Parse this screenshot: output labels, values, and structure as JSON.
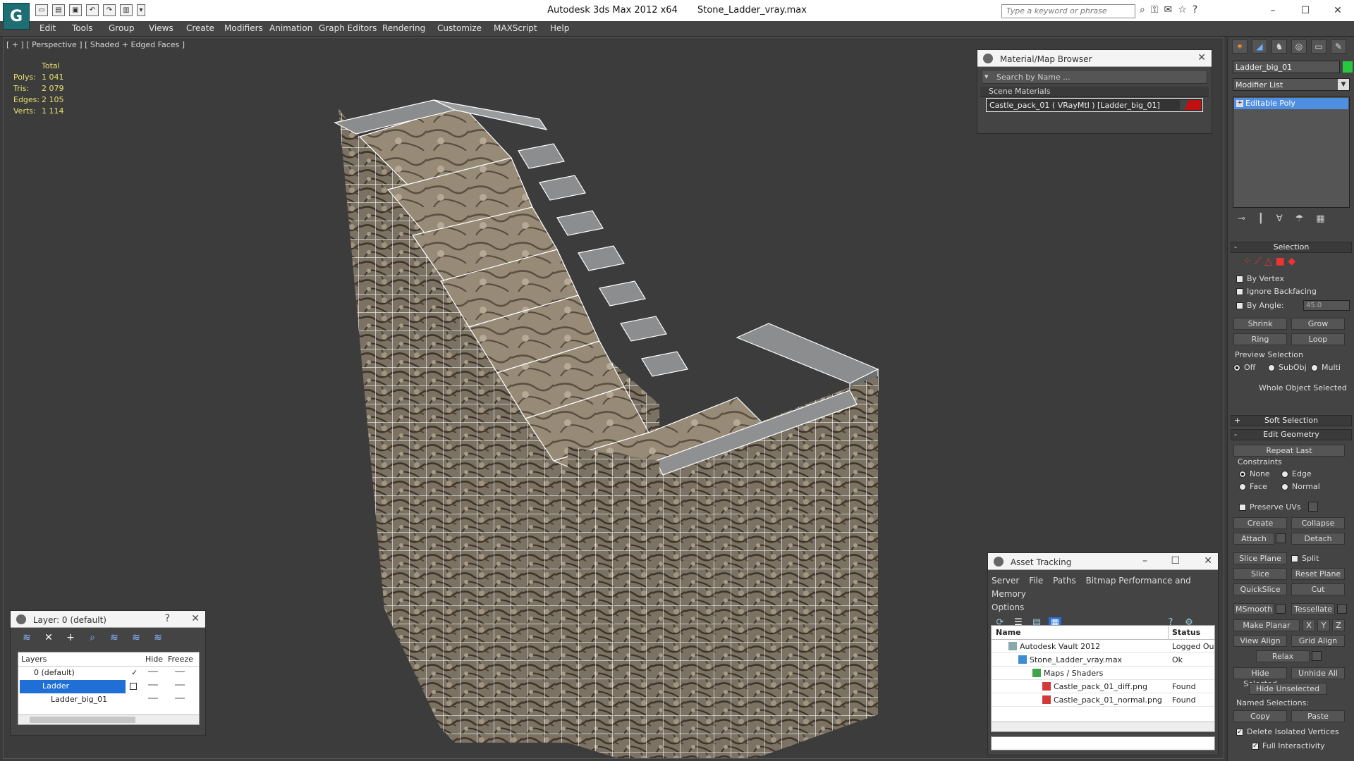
{
  "window": {
    "app_title": "Autodesk 3ds Max  2012 x64",
    "file_title": "Stone_Ladder_vray.max",
    "search_placeholder": "Type a keyword or phrase",
    "logo_glyph": "G"
  },
  "menu": [
    "Edit",
    "Tools",
    "Group",
    "Views",
    "Create",
    "Modifiers",
    "Animation",
    "Graph Editors",
    "Rendering",
    "Customize",
    "MAXScript",
    "Help"
  ],
  "viewport": {
    "label": "[ + ] [ Perspective ] [ Shaded + Edged Faces ]",
    "stats": {
      "header": "Total",
      "rows": [
        {
          "k": "Polys:",
          "v": "1 041"
        },
        {
          "k": "Tris:",
          "v": "2 079"
        },
        {
          "k": "Edges:",
          "v": "2 105"
        },
        {
          "k": "Verts:",
          "v": "1 114"
        }
      ]
    }
  },
  "material_browser": {
    "title": "Material/Map Browser",
    "search_placeholder": "Search by Name ...",
    "section": "Scene Materials",
    "item": "Castle_pack_01  ( VRayMtl )  [Ladder_big_01]"
  },
  "command_panel": {
    "object_name": "Ladder_big_01",
    "modifier_list": "Modifier List",
    "stack_item": "Editable Poly",
    "selection": {
      "header": "Selection",
      "by_vertex": "By Vertex",
      "ignore_backfacing": "Ignore Backfacing",
      "by_angle": "By Angle:",
      "angle_value": "45.0",
      "shrink": "Shrink",
      "grow": "Grow",
      "ring": "Ring",
      "loop": "Loop",
      "preview_selection": "Preview Selection",
      "off": "Off",
      "subobj": "SubObj",
      "multi": "Multi",
      "status": "Whole Object Selected"
    },
    "soft_selection": "Soft Selection",
    "edit_geometry": {
      "header": "Edit Geometry",
      "repeat_last": "Repeat Last",
      "constraints": "Constraints",
      "none": "None",
      "edge": "Edge",
      "face": "Face",
      "normal": "Normal",
      "preserve_uvs": "Preserve UVs",
      "create": "Create",
      "collapse": "Collapse",
      "attach": "Attach",
      "detach": "Detach",
      "slice_plane": "Slice Plane",
      "split": "Split",
      "slice": "Slice",
      "reset_plane": "Reset Plane",
      "quickslice": "QuickSlice",
      "cut": "Cut",
      "msmooth": "MSmooth",
      "tessellate": "Tessellate",
      "make_planar": "Make Planar",
      "x": "X",
      "y": "Y",
      "z": "Z",
      "view_align": "View Align",
      "grid_align": "Grid Align",
      "relax": "Relax",
      "hide_selected": "Hide Selected",
      "unhide_all": "Unhide All",
      "hide_unselected": "Hide Unselected",
      "named_selections": "Named Selections:",
      "copy": "Copy",
      "paste": "Paste",
      "delete_isolated": "Delete Isolated Vertices",
      "full_interactivity": "Full Interactivity"
    }
  },
  "layer_panel": {
    "title": "Layer: 0 (default)",
    "help": "?",
    "columns": {
      "layers": "Layers",
      "hide": "Hide",
      "freeze": "Freeze"
    },
    "rows": [
      {
        "name": "0 (default)"
      },
      {
        "name": "Ladder"
      },
      {
        "name": "Ladder_big_01"
      }
    ]
  },
  "asset_tracking": {
    "title": "Asset Tracking",
    "menu": [
      "Server",
      "File",
      "Paths",
      "Bitmap Performance and Memory",
      "Options"
    ],
    "columns": {
      "name": "Name",
      "status": "Status"
    },
    "rows": [
      {
        "name": "Autodesk Vault 2012",
        "status": "Logged Ou"
      },
      {
        "name": "Stone_Ladder_vray.max",
        "status": "Ok"
      },
      {
        "name": "Maps / Shaders",
        "status": ""
      },
      {
        "name": "Castle_pack_01_diff.png",
        "status": "Found"
      },
      {
        "name": "Castle_pack_01_normal.png",
        "status": "Found"
      }
    ]
  },
  "colors": {
    "accent_selection": "#4f8ee0",
    "object_color": "#27c840",
    "stats_text": "#e8e070"
  }
}
